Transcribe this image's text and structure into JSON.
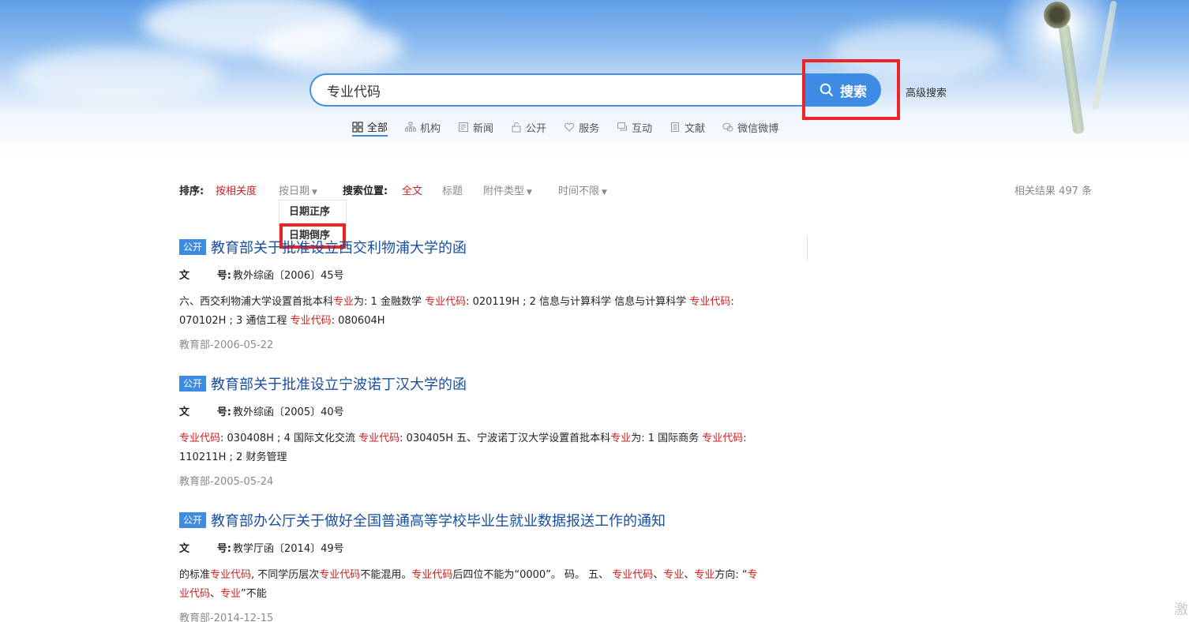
{
  "search": {
    "query": "专业代码",
    "button_label": "搜索",
    "advanced_label": "高级搜索"
  },
  "tabs": [
    {
      "label": "全部",
      "icon": "grid-icon",
      "active": true
    },
    {
      "label": "机构",
      "icon": "org-chart-icon",
      "active": false
    },
    {
      "label": "新闻",
      "icon": "newspaper-icon",
      "active": false
    },
    {
      "label": "公开",
      "icon": "lock-open-icon",
      "active": false
    },
    {
      "label": "服务",
      "icon": "heart-hand-icon",
      "active": false
    },
    {
      "label": "互动",
      "icon": "chat-icon",
      "active": false
    },
    {
      "label": "文献",
      "icon": "document-icon",
      "active": false
    },
    {
      "label": "微信微博",
      "icon": "wechat-icon",
      "active": false
    }
  ],
  "filter": {
    "sort_label": "排序:",
    "sort_relevance": "按相关度",
    "sort_date": "按日期",
    "position_label": "搜索位置:",
    "position_fulltext": "全文",
    "position_title": "标题",
    "attachment_type": "附件类型",
    "time_range": "时间不限",
    "result_count": "相关结果 497 条"
  },
  "dropdown": {
    "asc": "日期正序",
    "desc": "日期倒序"
  },
  "results": [
    {
      "badge": "公开",
      "title": "教育部关于批准设立西交利物浦大学的函",
      "doc_label_1": "文",
      "doc_label_2": "号:",
      "doc_no": "教外综函〔2006〕45号",
      "snippet": [
        {
          "t": "六、西交利物浦大学设置首批本科",
          "h": false
        },
        {
          "t": "专业",
          "h": true
        },
        {
          "t": "为: 1 金融数学 ",
          "h": false
        },
        {
          "t": "专业代码",
          "h": true
        },
        {
          "t": ": 020119H ; 2 信息与计算科学 信息与计算科学 ",
          "h": false
        },
        {
          "t": "专业代码",
          "h": true
        },
        {
          "t": ": 070102H ; 3 通信工程 ",
          "h": false
        },
        {
          "t": "专业代码",
          "h": true
        },
        {
          "t": ": 080604H",
          "h": false
        }
      ],
      "meta": "教育部-2006-05-22"
    },
    {
      "badge": "公开",
      "title": "教育部关于批准设立宁波诺丁汉大学的函",
      "doc_label_1": "文",
      "doc_label_2": "号:",
      "doc_no": "教外综函〔2005〕40号",
      "snippet": [
        {
          "t": "专业代码",
          "h": true
        },
        {
          "t": ": 030408H ; 4 国际文化交流 ",
          "h": false
        },
        {
          "t": "专业代码",
          "h": true
        },
        {
          "t": ": 030405H 五、宁波诺丁汉大学设置首批本科",
          "h": false
        },
        {
          "t": "专业",
          "h": true
        },
        {
          "t": "为: 1 国际商务 ",
          "h": false
        },
        {
          "t": "专业代码",
          "h": true
        },
        {
          "t": ": 110211H ; 2 财务管理",
          "h": false
        }
      ],
      "meta": "教育部-2005-05-24"
    },
    {
      "badge": "公开",
      "title": "教育部办公厅关于做好全国普通高等学校毕业生就业数据报送工作的通知",
      "doc_label_1": "文",
      "doc_label_2": "号:",
      "doc_no": "教学厅函〔2014〕49号",
      "snippet": [
        {
          "t": "的标准",
          "h": false
        },
        {
          "t": "专业代码",
          "h": true
        },
        {
          "t": ", 不同学历层次",
          "h": false
        },
        {
          "t": "专业代码",
          "h": true
        },
        {
          "t": "不能混用。",
          "h": false
        },
        {
          "t": "专业代码",
          "h": true
        },
        {
          "t": "后四位不能为“0000”。 码。 五、 ",
          "h": false
        },
        {
          "t": "专业代码",
          "h": true
        },
        {
          "t": "、",
          "h": false
        },
        {
          "t": "专业",
          "h": true
        },
        {
          "t": "、",
          "h": false
        },
        {
          "t": "专业",
          "h": true
        },
        {
          "t": "方向: “",
          "h": false
        },
        {
          "t": "专业代码",
          "h": true
        },
        {
          "t": "、",
          "h": false
        },
        {
          "t": "专业",
          "h": true
        },
        {
          "t": "”不能",
          "h": false
        }
      ],
      "meta": "教育部-2014-12-15"
    }
  ],
  "corner_text": "激"
}
